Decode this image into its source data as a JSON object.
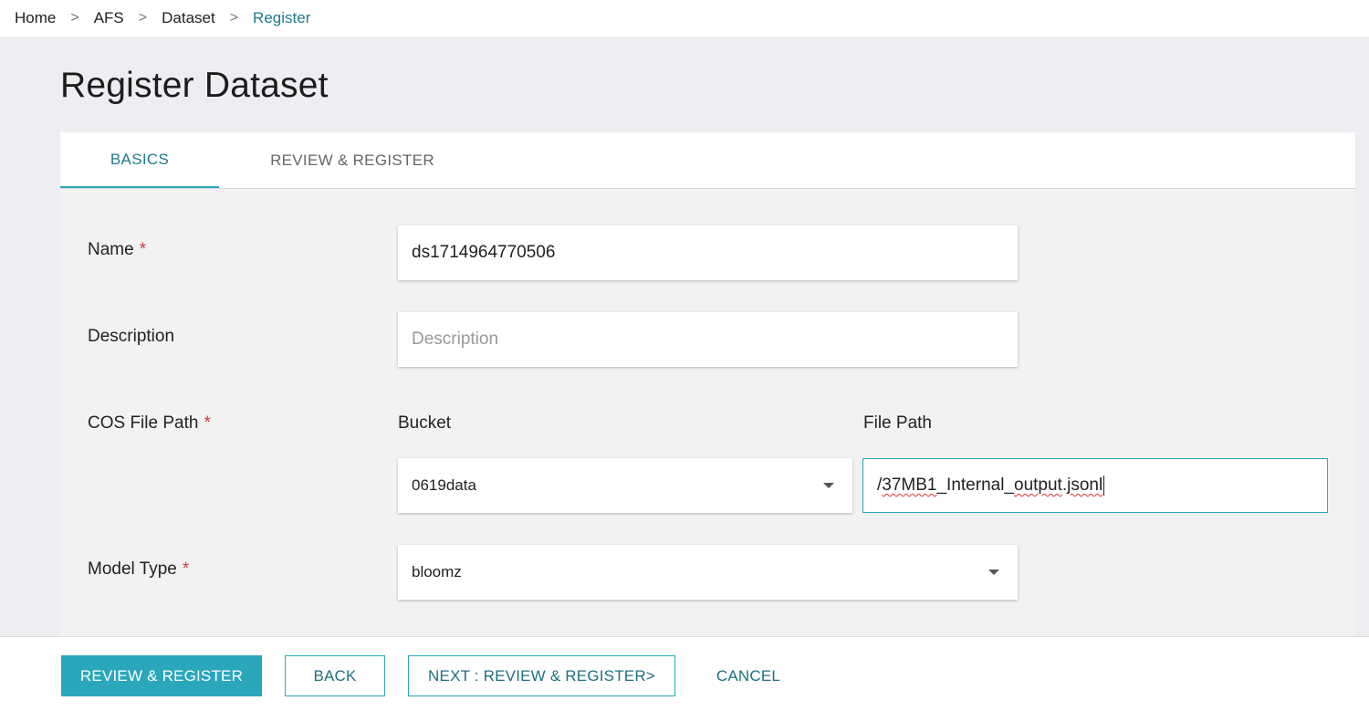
{
  "breadcrumb": {
    "items": [
      "Home",
      "AFS",
      "Dataset",
      "Register"
    ],
    "separator": ">"
  },
  "page_title": "Register Dataset",
  "tabs": [
    {
      "label": "BASICS",
      "active": true
    },
    {
      "label": "REVIEW & REGISTER",
      "active": false
    }
  ],
  "form": {
    "name": {
      "label": "Name",
      "required_mark": "*",
      "value": "ds1714964770506"
    },
    "description": {
      "label": "Description",
      "placeholder": "Description",
      "value": ""
    },
    "cos_file_path": {
      "label": "COS File Path",
      "required_mark": "*",
      "bucket_label": "Bucket",
      "bucket_value": "0619data",
      "file_path_label": "File Path",
      "file_path_value": "/37MB1_Internal_output.jsonl",
      "file_path_parts": [
        "/",
        "37MB1",
        "_Internal_",
        "output",
        ".",
        "jsonl"
      ]
    },
    "model_type": {
      "label": "Model Type",
      "required_mark": "*",
      "value": "bloomz"
    }
  },
  "footer": {
    "review_register": "REVIEW & REGISTER",
    "back": "BACK",
    "next": "NEXT : REVIEW & REGISTER>",
    "cancel": "CANCEL"
  },
  "colors": {
    "accent": "#2aa7ba",
    "accent_text": "#1f7a8c",
    "required": "#d0393e",
    "page_bg": "#eceef1"
  },
  "icons": [
    "chevron-down-icon"
  ]
}
